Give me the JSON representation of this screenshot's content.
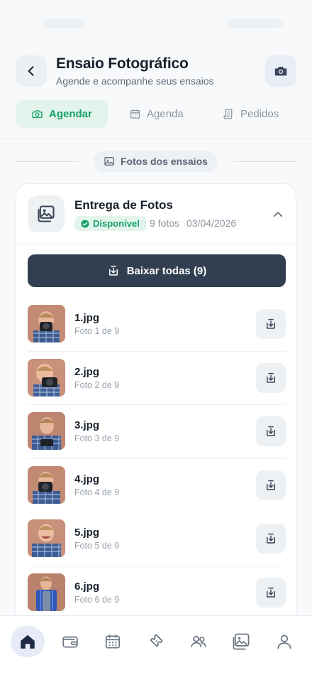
{
  "header": {
    "title": "Ensaio Fotográfico",
    "subtitle": "Agende e acompanhe seus ensaios"
  },
  "tabs": [
    {
      "label": "Agendar",
      "icon": "camera-icon",
      "active": true
    },
    {
      "label": "Agenda",
      "icon": "calendar-icon",
      "active": false
    },
    {
      "label": "Pedidos",
      "icon": "receipt-icon",
      "active": false
    }
  ],
  "section": {
    "label": "Fotos dos ensaios",
    "icon": "photos-icon"
  },
  "card": {
    "title": "Entrega de Fotos",
    "status": "Disponível",
    "count_text": "9 fotos",
    "date": "03/04/2026",
    "download_all_label": "Baixar todas (9)"
  },
  "photos": [
    {
      "name": "1.jpg",
      "caption": "Foto 1 de 9"
    },
    {
      "name": "2.jpg",
      "caption": "Foto 2 de 9"
    },
    {
      "name": "3.jpg",
      "caption": "Foto 3 de 9"
    },
    {
      "name": "4.jpg",
      "caption": "Foto 4 de 9"
    },
    {
      "name": "5.jpg",
      "caption": "Foto 5 de 9"
    },
    {
      "name": "6.jpg",
      "caption": "Foto 6 de 9"
    }
  ],
  "bottom_nav": [
    {
      "icon": "home-icon",
      "active": true
    },
    {
      "icon": "wallet-icon",
      "active": false
    },
    {
      "icon": "calendar-icon",
      "active": false
    },
    {
      "icon": "ticket-icon",
      "active": false
    },
    {
      "icon": "users-icon",
      "active": false
    },
    {
      "icon": "gallery-icon",
      "active": false
    },
    {
      "icon": "profile-icon",
      "active": false
    }
  ],
  "colors": {
    "accent_green": "#16a06a",
    "dark_button": "#323f51",
    "nav_active_bg": "#e7ebf7"
  }
}
